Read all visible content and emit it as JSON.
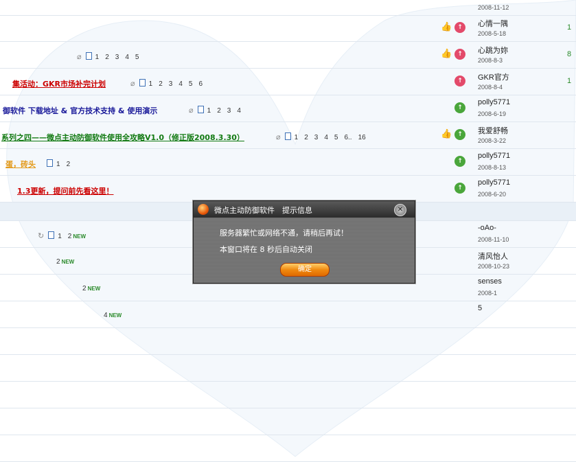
{
  "threads": [
    {
      "title": "",
      "pages": [],
      "author": "",
      "date": "2008-11-12",
      "count": ""
    },
    {
      "title": "",
      "pages": [],
      "author": "心情一隅",
      "date": "2008-5-18",
      "count": "1",
      "thumb": true,
      "arrow": "red"
    },
    {
      "title": "",
      "pages": [
        "1",
        "2",
        "3",
        "4",
        "5"
      ],
      "author": "心跳为妳",
      "date": "2008-8-3",
      "count": "8",
      "thumb": true,
      "arrow": "red"
    },
    {
      "title": "集活动：GKR市场补完计划",
      "color": "#cc0000",
      "pages": [
        "1",
        "2",
        "3",
        "4",
        "5",
        "6"
      ],
      "clip": true,
      "author": "GKR官方",
      "date": "2008-8-4",
      "count": "1",
      "arrow": "red"
    },
    {
      "title": "御软件 下载地址 & 官方技术支持 & 使用演示",
      "color": "#1a1a9a",
      "pages": [
        "1",
        "2",
        "3",
        "4"
      ],
      "clip": true,
      "author": "polly5771",
      "date": "2008-6-19",
      "count": "",
      "arrow": "green"
    },
    {
      "title": "系列之四——微点主动防御软件使用全攻略V1.0（修正版2008.3.30）",
      "color": "#127a12",
      "pages": [
        "1",
        "2",
        "3",
        "4",
        "5",
        "6..",
        "16"
      ],
      "clip": true,
      "author": "我爱舒畅",
      "date": "2008-3-22",
      "count": "",
      "thumb": true,
      "arrow": "green"
    },
    {
      "title": "蛋，砖头",
      "color": "#e39a1a",
      "pages": [
        "1",
        "2"
      ],
      "author": "polly5771",
      "date": "2008-8-13",
      "count": "",
      "arrow": "green"
    },
    {
      "title": "1.3更新，提问前先看这里！",
      "color": "#cc0000",
      "pages": [],
      "author": "polly5771",
      "date": "2008-6-20",
      "count": "",
      "arrow": "green"
    }
  ],
  "recent": [
    {
      "pages": [
        "1",
        "2"
      ],
      "new_label": "NEW",
      "author": "-oAo-",
      "date": "2008-11-10"
    },
    {
      "pages": [
        "2"
      ],
      "new_label": "NEW",
      "author": "清风怡人",
      "date": "2008-10-23"
    },
    {
      "pages": [
        "2"
      ],
      "new_label": "NEW",
      "author": "senses",
      "date": "2008-1"
    },
    {
      "pages": [
        "4"
      ],
      "new_label": "NEW",
      "author": "5",
      "date": ""
    }
  ],
  "dialog": {
    "title": "微点主动防御软件　提示信息",
    "message": "服务器繁忙或网络不通，请稍后再试！",
    "countdown": "本窗口将在 8 秒后自动关闭",
    "ok_label": "确定",
    "close_glyph": "✕"
  },
  "icons": {
    "thumb": "thumbs-up-icon",
    "arrow": "top-arrow-icon",
    "doc": "page-icon",
    "clip": "attachment-icon"
  },
  "colors": {
    "row_border": "#dfe6ee",
    "section_bg": "#e9f0f7",
    "heart_tint": "#f4f8fc"
  }
}
